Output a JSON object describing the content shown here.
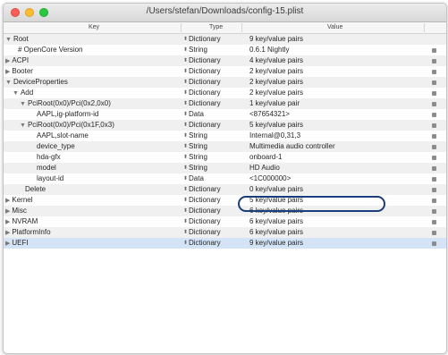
{
  "window": {
    "title": "/Users/stefan/Downloads/config-15.plist"
  },
  "columns": {
    "key": "Key",
    "type": "Type",
    "value": "Value"
  },
  "rows": [
    {
      "key": "Root",
      "disclosure": "▼",
      "type": "Dictionary",
      "value": "9 key/value pairs"
    },
    {
      "key": "# OpenCore Version",
      "disclosure": "",
      "type": "String",
      "value": "0.6.1 Nightly"
    },
    {
      "key": "ACPI",
      "disclosure": "▶",
      "type": "Dictionary",
      "value": "4 key/value pairs"
    },
    {
      "key": "Booter",
      "disclosure": "▶",
      "type": "Dictionary",
      "value": "2 key/value pairs"
    },
    {
      "key": "DeviceProperties",
      "disclosure": "▼",
      "type": "Dictionary",
      "value": "2 key/value pairs"
    },
    {
      "key": "Add",
      "disclosure": "▼",
      "type": "Dictionary",
      "value": "2 key/value pairs"
    },
    {
      "key": "PciRoot(0x0)/Pci(0x2,0x0)",
      "disclosure": "▼",
      "type": "Dictionary",
      "value": "1 key/value pair"
    },
    {
      "key": "AAPL,ig-platform-id",
      "disclosure": "",
      "type": "Data",
      "value": "<87654321>"
    },
    {
      "key": "PciRoot(0x0)/Pci(0x1F,0x3)",
      "disclosure": "▼",
      "type": "Dictionary",
      "value": "5 key/value pairs"
    },
    {
      "key": "AAPL,slot-name",
      "disclosure": "",
      "type": "String",
      "value": "Internal@0,31,3"
    },
    {
      "key": "device_type",
      "disclosure": "",
      "type": "String",
      "value": "Multimedia audio controller"
    },
    {
      "key": "hda-gfx",
      "disclosure": "",
      "type": "String",
      "value": "onboard-1"
    },
    {
      "key": "model",
      "disclosure": "",
      "type": "String",
      "value": "HD Audio"
    },
    {
      "key": "layout-id",
      "disclosure": "",
      "type": "Data",
      "value": "<1C000000>"
    },
    {
      "key": "Delete",
      "disclosure": "",
      "type": "Dictionary",
      "value": "0 key/value pairs"
    },
    {
      "key": "Kernel",
      "disclosure": "▶",
      "type": "Dictionary",
      "value": "5 key/value pairs"
    },
    {
      "key": "Misc",
      "disclosure": "▶",
      "type": "Dictionary",
      "value": "6 key/value pairs"
    },
    {
      "key": "NVRAM",
      "disclosure": "▶",
      "type": "Dictionary",
      "value": "6 key/value pairs"
    },
    {
      "key": "PlatformInfo",
      "disclosure": "▶",
      "type": "Dictionary",
      "value": "6 key/value pairs"
    },
    {
      "key": "UEFI",
      "disclosure": "▶",
      "type": "Dictionary",
      "value": "9 key/value pairs"
    }
  ],
  "highlight": {
    "row_key": "layout-id",
    "color": "#1b3e7a"
  },
  "selected_row": "UEFI",
  "colors": {
    "selection": "#d4e3f5",
    "close": "#fc5f57",
    "minimize": "#fdbc2e",
    "maximize": "#29c83f"
  }
}
